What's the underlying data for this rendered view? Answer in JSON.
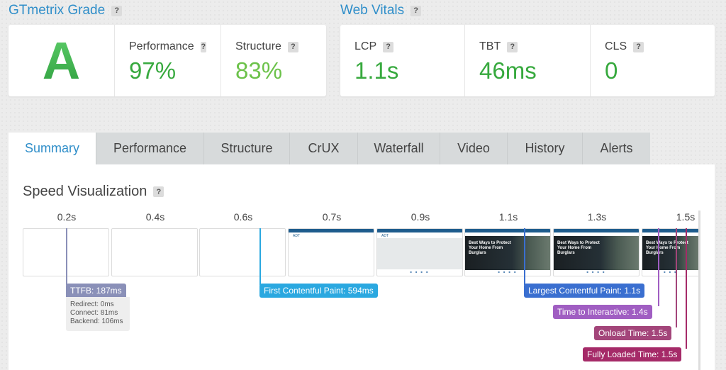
{
  "grade": {
    "title": "GTmetrix Grade",
    "letter": "A",
    "performance": {
      "label": "Performance",
      "value": "97%"
    },
    "structure": {
      "label": "Structure",
      "value": "83%"
    }
  },
  "vitals": {
    "title": "Web Vitals",
    "lcp": {
      "label": "LCP",
      "value": "1.1s"
    },
    "tbt": {
      "label": "TBT",
      "value": "46ms"
    },
    "cls": {
      "label": "CLS",
      "value": "0"
    }
  },
  "help_glyph": "?",
  "tabs": [
    {
      "label": "Summary",
      "active": true
    },
    {
      "label": "Performance"
    },
    {
      "label": "Structure"
    },
    {
      "label": "CrUX"
    },
    {
      "label": "Waterfall"
    },
    {
      "label": "Video"
    },
    {
      "label": "History"
    },
    {
      "label": "Alerts"
    }
  ],
  "speed": {
    "title": "Speed Visualization",
    "times": [
      "0.2s",
      "0.4s",
      "0.6s",
      "0.7s",
      "0.9s",
      "1.1s",
      "1.3s",
      "1.5s"
    ],
    "frame_headline": "Best Ways to Protect Your Home From Burglars",
    "frame_logo": "ADT",
    "markers": {
      "ttfb": "TTFB: 187ms",
      "fcp": "First Contentful Paint: 594ms",
      "lcp": "Largest Contentful Paint: 1.1s",
      "tti": "Time to Interactive: 1.4s",
      "onload": "Onload Time: 1.5s",
      "fully": "Fully Loaded Time: 1.5s"
    },
    "ttfb_breakdown": {
      "redirect": "Redirect: 0ms",
      "connect": "Connect: 81ms",
      "backend": "Backend: 106ms"
    }
  },
  "colors": {
    "ttfb": "#8a90b8",
    "fcp": "#2aa8e0",
    "lcp": "#3a6fd0",
    "tti": "#a05ec2",
    "onload": "#a3457a",
    "fully": "#a52a68"
  }
}
